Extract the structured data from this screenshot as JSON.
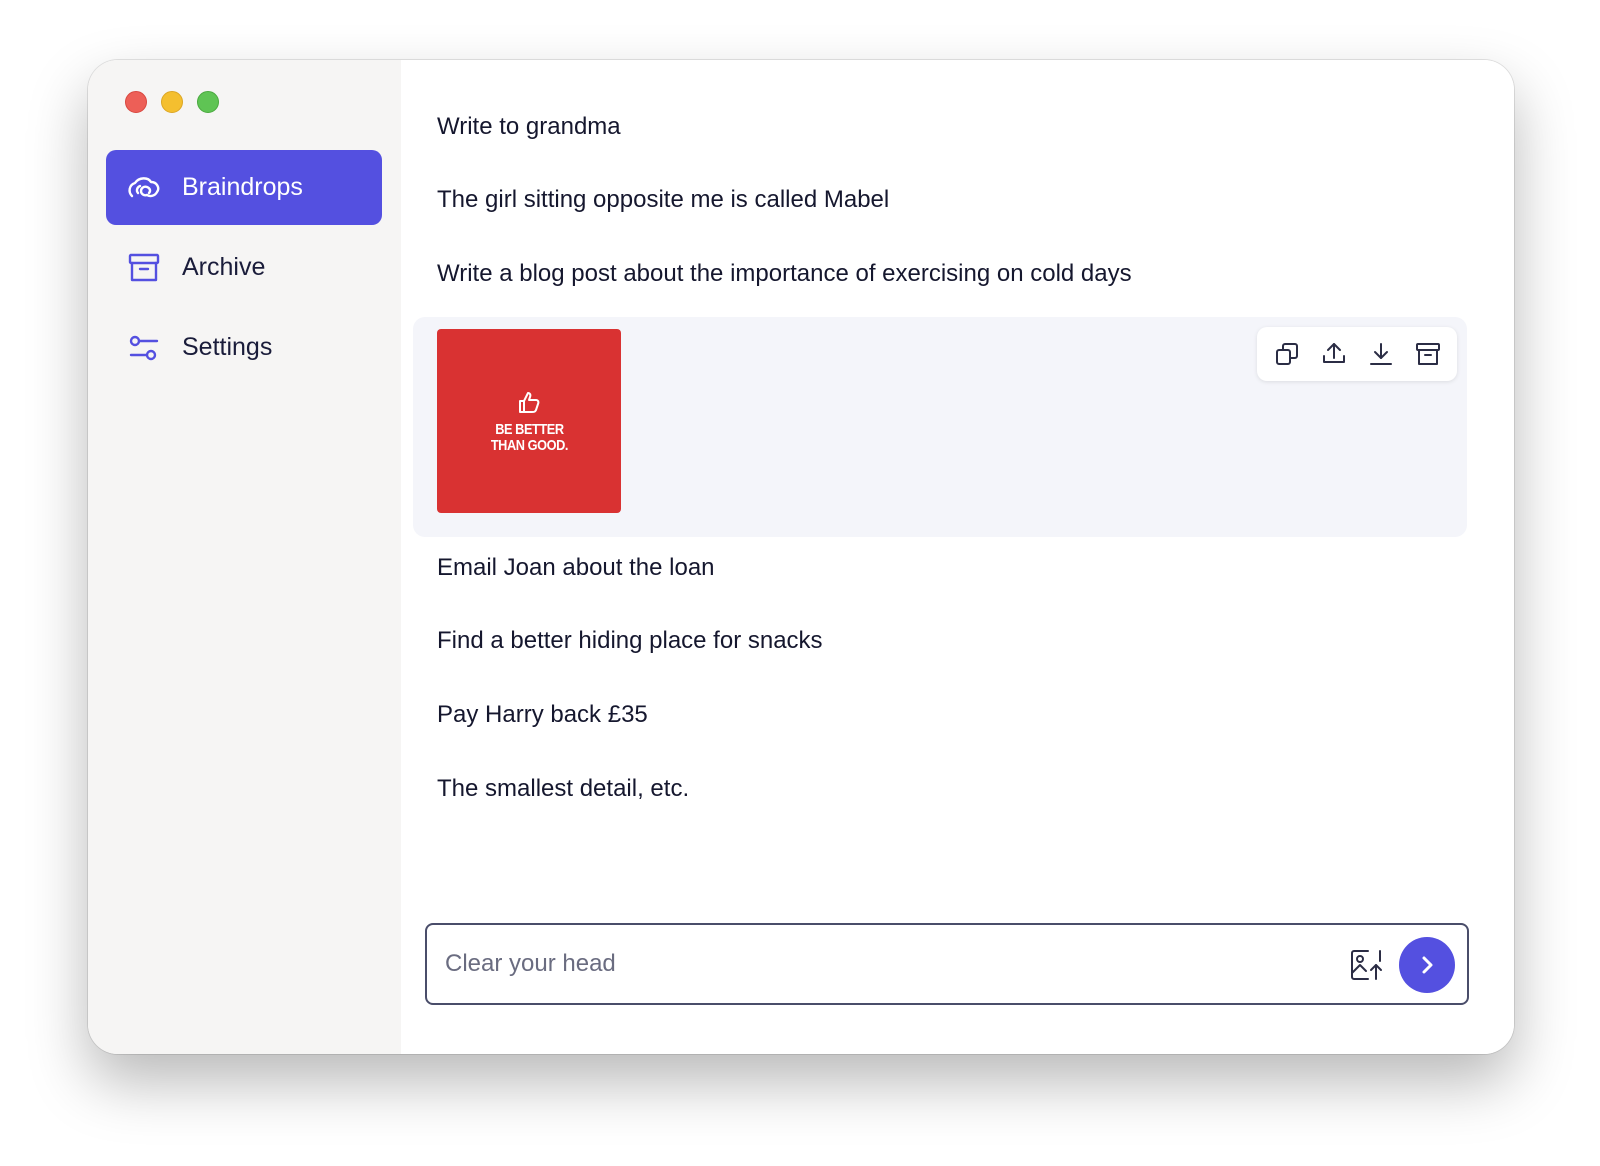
{
  "app": {
    "accent_color": "#5450e0"
  },
  "sidebar": {
    "items": [
      {
        "label": "Braindrops",
        "icon": "braindrop-swirl-icon",
        "active": true
      },
      {
        "label": "Archive",
        "icon": "archive-box-icon",
        "active": false
      },
      {
        "label": "Settings",
        "icon": "sliders-icon",
        "active": false
      }
    ]
  },
  "notes": [
    "Write to grandma",
    "The girl sitting opposite me is called Mabel",
    "Write a blog post about the importance of exercising on cold days",
    "Email Joan about the loan",
    "Find a better hiding place for snacks",
    "Pay Harry back £35",
    "The smallest detail, etc."
  ],
  "image_note": {
    "image_text_line1": "BE BETTER",
    "image_text_line2": "THAN GOOD.",
    "image_bg_color": "#d93232",
    "toolbar_icons": [
      "copy-icon",
      "share-icon",
      "download-icon",
      "archive-icon"
    ]
  },
  "composer": {
    "placeholder": "Clear your head",
    "value": ""
  }
}
